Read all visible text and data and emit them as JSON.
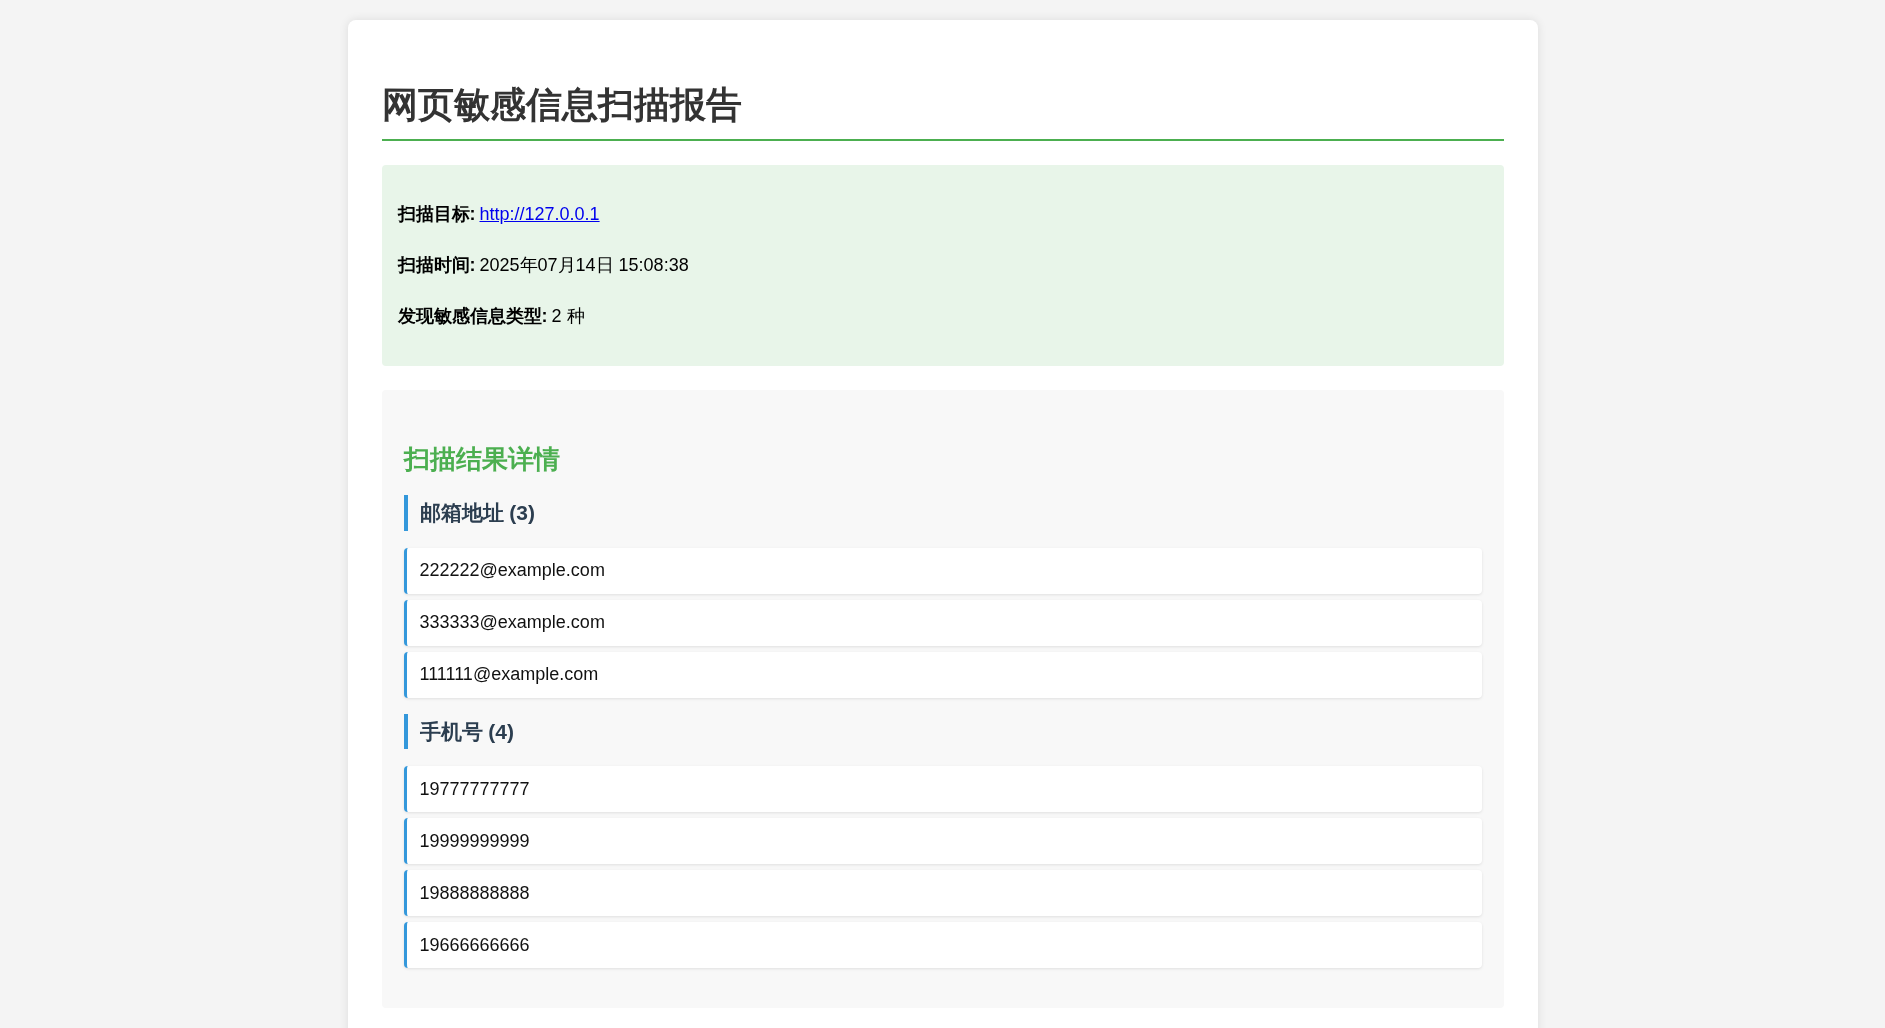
{
  "title": "网页敏感信息扫描报告",
  "summary": [
    {
      "label": "扫描目标:",
      "value": "http://127.0.0.1",
      "kind": "link"
    },
    {
      "label": "扫描时间:",
      "value": "2025年07月14日 15:08:38",
      "kind": "text"
    },
    {
      "label": "发现敏感信息类型:",
      "value": "2 种",
      "kind": "text"
    }
  ],
  "results": {
    "heading": "扫描结果详情",
    "groups": [
      {
        "heading": "邮箱地址 (3)",
        "items": [
          "222222@example.com",
          "333333@example.com",
          "111111@example.com"
        ]
      },
      {
        "heading": "手机号 (4)",
        "items": [
          "19777777777",
          "19999999999",
          "19888888888",
          "19666666666"
        ]
      }
    ]
  }
}
